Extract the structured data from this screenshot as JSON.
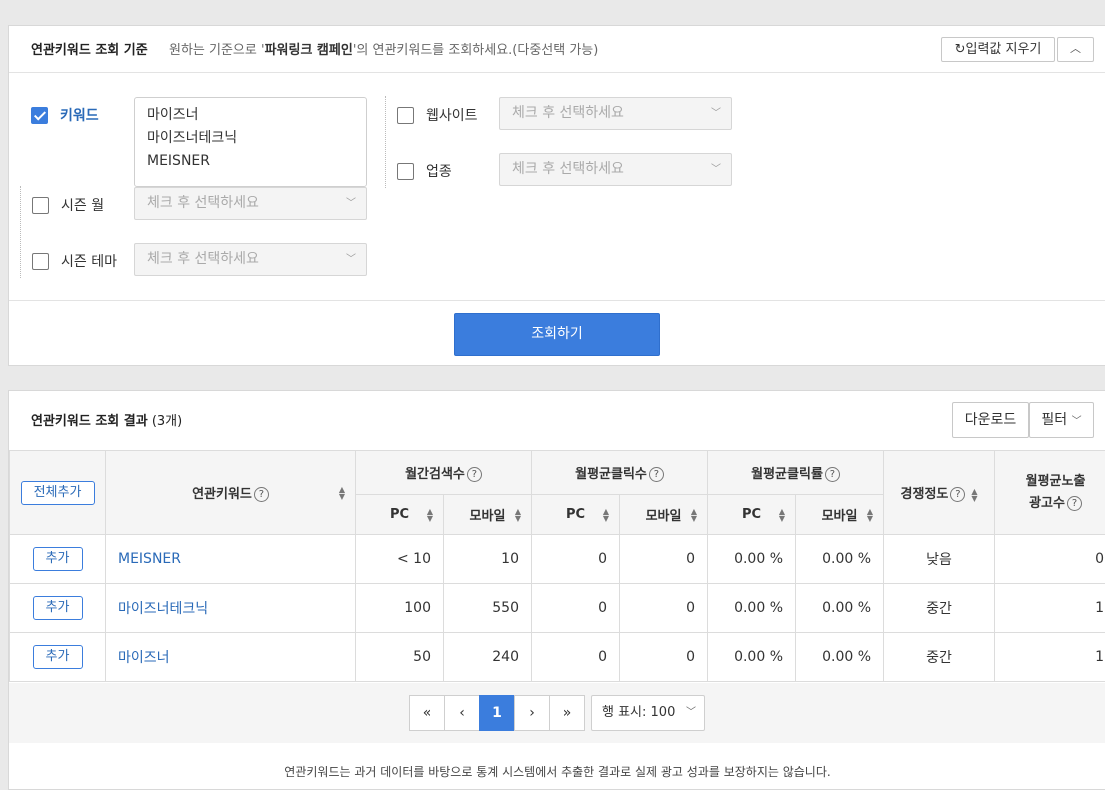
{
  "criteria_panel": {
    "title": "연관키워드 조회 기준",
    "desc_prefix": "원하는 기준으로 '",
    "desc_bold": "파워링크 캠페인",
    "desc_suffix": "'의 연관키워드를 조회하세요.(다중선택 가능)",
    "reset_label": "입력값 지우기",
    "reset_icon": "refresh-icon",
    "collapse_icon": "chevron-up-icon",
    "keyword": {
      "label": "키워드",
      "checked": true,
      "lines": [
        "마이즈너",
        "마이즈너테크닉",
        "MEISNER"
      ]
    },
    "season_month": {
      "label": "시즌 월",
      "checked": false,
      "placeholder": "체크 후 선택하세요"
    },
    "season_theme": {
      "label": "시즌 테마",
      "checked": false,
      "placeholder": "체크 후 선택하세요"
    },
    "website": {
      "label": "웹사이트",
      "checked": false,
      "placeholder": "체크 후 선택하세요"
    },
    "industry": {
      "label": "업종",
      "checked": false,
      "placeholder": "체크 후 선택하세요"
    },
    "search_label": "조회하기",
    "accent_color": "#3b7ddd"
  },
  "results_panel": {
    "title": "연관키워드 조회 결과",
    "count": "(3개)",
    "download_label": "다운로드",
    "filter_label": "필터",
    "headers": {
      "add_all": "전체추가",
      "keyword": "연관키워드",
      "monthly_search": "월간검색수",
      "avg_clicks": "월평균클릭수",
      "avg_ctr": "월평균클릭률",
      "competition": "경쟁정도",
      "ad_count_line1": "월평균노출",
      "ad_count_line2": "광고수",
      "pc": "PC",
      "mobile": "모바일"
    },
    "rows": [
      {
        "add": "추가",
        "keyword": "MEISNER",
        "search_pc": "< 10",
        "search_mobile": "10",
        "clicks_pc": "0",
        "clicks_mobile": "0",
        "ctr_pc": "0.00 %",
        "ctr_mobile": "0.00 %",
        "competition": "낮음",
        "ad_count": "0"
      },
      {
        "add": "추가",
        "keyword": "마이즈너테크닉",
        "search_pc": "100",
        "search_mobile": "550",
        "clicks_pc": "0",
        "clicks_mobile": "0",
        "ctr_pc": "0.00 %",
        "ctr_mobile": "0.00 %",
        "competition": "중간",
        "ad_count": "1"
      },
      {
        "add": "추가",
        "keyword": "마이즈너",
        "search_pc": "50",
        "search_mobile": "240",
        "clicks_pc": "0",
        "clicks_mobile": "0",
        "ctr_pc": "0.00 %",
        "ctr_mobile": "0.00 %",
        "competition": "중간",
        "ad_count": "1"
      }
    ],
    "pager": {
      "first": "«",
      "prev": "‹",
      "current": "1",
      "next": "›",
      "last": "»"
    },
    "rows_per_page": "행 표시: 100",
    "notice": "연관키워드는 과거 데이터를 바탕으로 통계 시스템에서 추출한 결과로 실제 광고 성과를 보장하지는 않습니다."
  }
}
